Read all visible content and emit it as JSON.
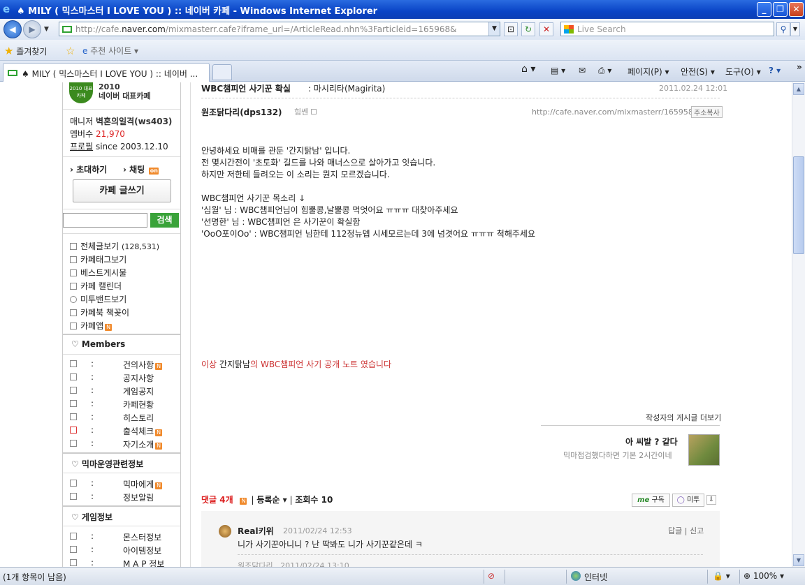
{
  "window": {
    "title": "♠ MILY ( 믹스마스터 I LOVE YOU ) :: 네이버 카페 - Windows Internet Explorer",
    "minimize": "_",
    "maximize": "❐",
    "close": "✕"
  },
  "address_bar": {
    "url_prefix": "http://cafe.",
    "url_domain": "naver.com",
    "url_rest": "/mixmasterr.cafe?iframe_url=/ArticleRead.nhn%3Farticleid=165968&",
    "search_placeholder": "Live Search"
  },
  "favorites_bar": {
    "favorites_label": "즐겨찾기",
    "suggested_sites_label": "추천 사이트 ▾"
  },
  "tabs": {
    "active_tab_title": "♠ MILY ( 믹스마스터 I LOVE YOU ) :: 네이버 ...",
    "page_menu": "페이지(P) ▾",
    "safety_menu": "안전(S) ▾",
    "tools_menu": "도구(O) ▾",
    "help_menu": "? ▾",
    "more": "»"
  },
  "sidebar": {
    "badge_text": "2010 대표카페",
    "cafe_label_year": "2010",
    "cafe_label_name": "네이버 대표카페",
    "manager_label": "매니저",
    "manager_name": "벽혼의일격(ws403)",
    "members_label": "멤버수",
    "members_count": "21,970",
    "profile_link": "프로필",
    "since_text": "since 2003.12.10",
    "invite_link": "› 초대하기",
    "chat_link": "› 채팅",
    "chat_badge": "on",
    "write_button": "카페 글쓰기",
    "search_button": "검색",
    "menu_items": [
      {
        "label": "전체글보기",
        "count": "(128,531)"
      },
      {
        "label": "카페태그보기"
      },
      {
        "label": "베스트게시물"
      },
      {
        "label": "카페 캘린더"
      },
      {
        "label": "미투밴드보기"
      },
      {
        "label": "카페북 책꽂이"
      },
      {
        "label": "카페앱"
      }
    ],
    "members_section_title": "♡ Members",
    "members_menu": [
      "건의사항",
      "공지사항",
      "게임공지",
      "카페현황",
      "히스토리",
      "출석체크",
      "자기소개"
    ],
    "mima_section_title": "♡ 믹마운영관련정보",
    "mima_menu": [
      "믹마에게",
      "정보알림"
    ],
    "game_section_title": "♡ 게임정보",
    "game_menu": [
      "몬스터정보",
      "아이템정보",
      "M A P 정보"
    ],
    "colon": ":",
    "new_badge": "N"
  },
  "article": {
    "title": "WBC챔피언 사기꾼 확실",
    "title_suffix": ": 마시리타(Magirita)",
    "date": "2011.02.24 12:01",
    "author": "원조닭다리(dps132)",
    "author_grade": "힘쎈",
    "article_url": "http://cafe.naver.com/mixmasterr/165958",
    "copy_url_button": "주소복사",
    "body": [
      "안녕하세요 비매를 관둔 '간지탉남' 입니다.",
      "전 몇시간전이 '초토화' 길드를 나와 매너스으로 살아가고 잇습니다.",
      "하지만 저한테 들려오는 이 소리는 뭔지 모르겠습니다.",
      "WBC챔피언 사기꾼 목소리 ↓",
      "'심월' 님 : WBC챔피언님이 힘뿔콩,날뿔콩 먹엇어요 ㅠㅠㅠ 대찾아주세요",
      "'선명한' 님 : WBC챔피언 은 사기꾼이 확실함",
      "'OoO포이Oo' : WBC챔피언 님한테 112정뉴뎁 시세모르는데 3에 넘겻어요 ㅠㅠㅠ 척해주세요"
    ],
    "conclusion_a": "이상",
    "conclusion_b": "간지탉남",
    "conclusion_c": "의 WBC챔피언 사기 공개 노트 였습니다",
    "more_by_author": "작성자의 게시글 더보기",
    "related_title": "아 씨발 ? 같다",
    "related_sub": "믹마접검했다하면 기본 2시간이네",
    "comments_label": "댓글 4개",
    "sort_label": "등록순 ▾",
    "views_label": "조회수 10",
    "me_subscribe": "구독",
    "me_logo": "me",
    "metoo_button": "미투",
    "download_icon": "⇩"
  },
  "comments": [
    {
      "name": "Real키위",
      "date": "2011/02/24 12:53",
      "text": "니가 사기꾼아니니 ? 난 딱봐도 니가 사기꾼같은데 ㅋ",
      "reply": "답글",
      "report": "신고"
    }
  ],
  "reply_preview": {
    "name": "원조닭다리",
    "date": "2011/02/24 13:10"
  },
  "status_bar": {
    "status_text": "(1개 항목이 남음)",
    "zone": "인터넷",
    "zoom": "100%"
  }
}
